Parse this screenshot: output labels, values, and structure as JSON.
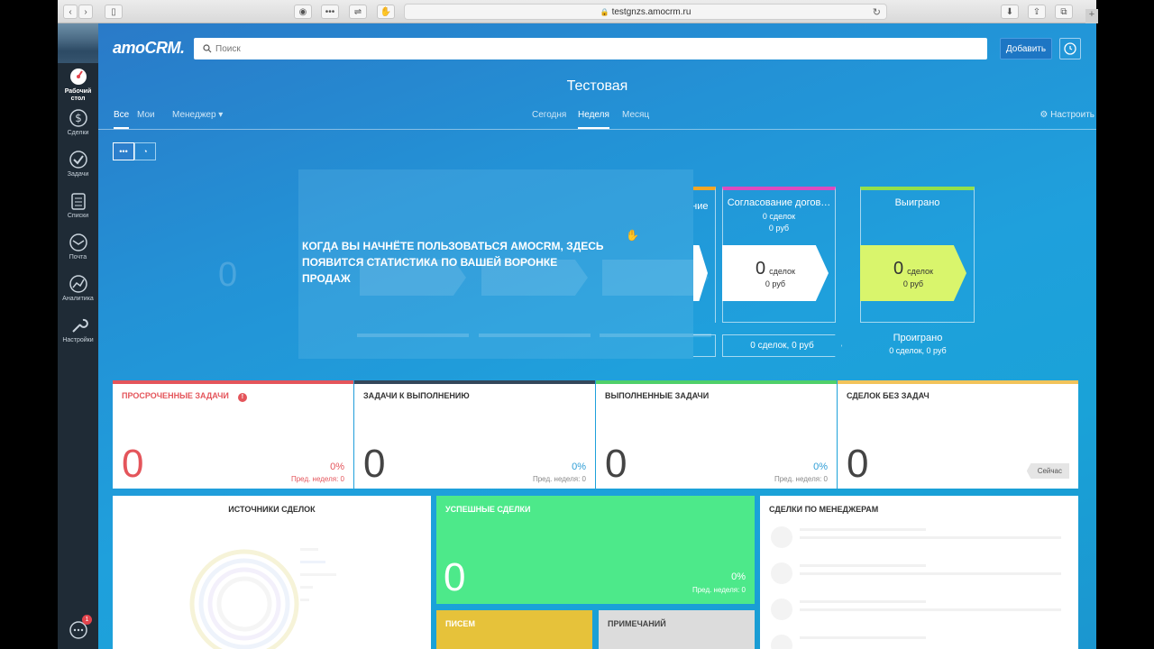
{
  "browser": {
    "url": "testgnzs.amocrm.ru",
    "plus": "+"
  },
  "sidebar": {
    "items": [
      {
        "label": "Рабочий стол",
        "icon": "dashboard-icon"
      },
      {
        "label": "Сделки",
        "icon": "dollar-icon"
      },
      {
        "label": "Задачи",
        "icon": "check-icon"
      },
      {
        "label": "Списки",
        "icon": "list-icon"
      },
      {
        "label": "Почта",
        "icon": "mail-icon"
      },
      {
        "label": "Аналитика",
        "icon": "analytics-icon"
      },
      {
        "label": "Настройки",
        "icon": "wrench-icon"
      }
    ],
    "chat_badge": "1"
  },
  "header": {
    "logo": "amoCRM.",
    "search_placeholder": "Поиск",
    "add_label": "Добавить"
  },
  "page_title": "Тестовая",
  "filters": {
    "owner_tabs": [
      "Все",
      "Мои"
    ],
    "manager_label": "Менеджер ▾",
    "period_tabs": [
      "Сегодня",
      "Неделя",
      "Месяц"
    ],
    "settings_label": "Настроить"
  },
  "pipeline": {
    "overlay_message": "КОГДА ВЫ НАЧНЁТЕ ПОЛЬЗОВАТЬСЯ AMOCRM, ЗДЕСЬ ПОЯВИТСЯ СТАТИСТИКА ПО ВАШЕЙ ВОРОНКЕ ПРОДАЖ",
    "ghost_zero": "0",
    "partial_stage_text": "ание",
    "stages": [
      {
        "title": "Согласование догов…",
        "deals": "0 сделок",
        "sum": "0 руб",
        "count": "0",
        "unit": "сделок",
        "rub": "0 руб",
        "pill": "0 сделок, 0 руб",
        "color": "#dc4bbf"
      },
      {
        "title": "Выиграно",
        "deals": "",
        "sum": "",
        "count": "0",
        "unit": "сделок",
        "rub": "0 руб",
        "color": "#93e04b"
      }
    ],
    "lost_title": "Проиграно",
    "lost_sub": "0 сделок, 0 руб"
  },
  "widgets": [
    {
      "title": "ПРОСРОЧЕННЫЕ ЗАДАЧИ",
      "value": "0",
      "pct": "0%",
      "prev": "Пред. неделя: 0",
      "color": "#e4555b"
    },
    {
      "title": "ЗАДАЧИ К ВЫПОЛНЕНИЮ",
      "value": "0",
      "pct": "0%",
      "prev": "Пред. неделя: 0",
      "color": "#33475b"
    },
    {
      "title": "ВЫПОЛНЕННЫЕ ЗАДАЧИ",
      "value": "0",
      "pct": "0%",
      "prev": "Пред. неделя: 0",
      "color": "#4fd06a"
    },
    {
      "title": "СДЕЛОК БЕЗ ЗАДАЧ",
      "value": "0",
      "now": "Сейчас",
      "color": "#f2c35a"
    }
  ],
  "bottom": {
    "sources_title": "ИСТОЧНИКИ СДЕЛОК",
    "success_title": "УСПЕШНЫЕ СДЕЛКИ",
    "success_value": "0",
    "success_pct": "0%",
    "success_prev": "Пред. неделя: 0",
    "letters_title": "ПИСЕМ",
    "notes_title": "ПРИМЕЧАНИЙ",
    "managers_title": "СДЕЛКИ ПО МЕНЕДЖЕРАМ"
  }
}
